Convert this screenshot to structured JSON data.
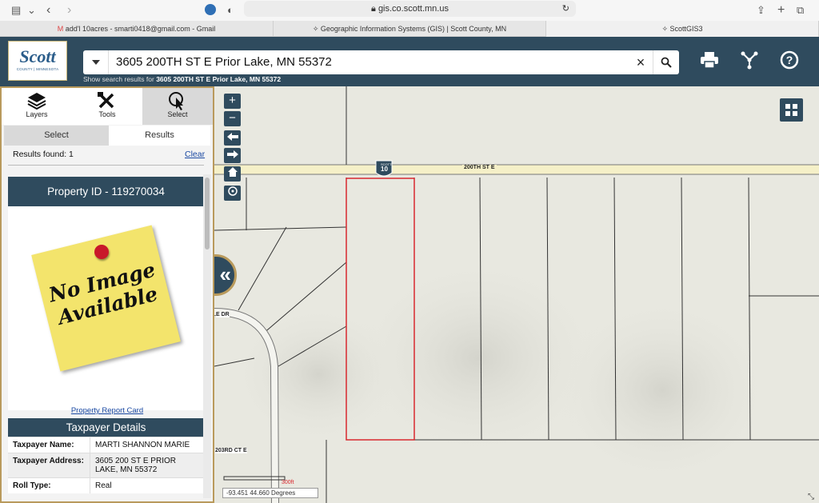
{
  "browser": {
    "url": "gis.co.scott.mn.us",
    "tabs": [
      {
        "label": "add'l 10acres - smarti0418@gmail.com - Gmail"
      },
      {
        "label": "Geographic Information Systems (GIS) | Scott County, MN"
      },
      {
        "label": "ScottGIS3"
      }
    ]
  },
  "header": {
    "logo_main": "Scott",
    "logo_sub": "COUNTY | MINNESOTA",
    "search_value": "3605 200TH ST E Prior Lake, MN 55372",
    "hint_prefix": "Show search results for",
    "hint_query": "3605 200TH ST E Prior Lake, MN 55372"
  },
  "panel": {
    "tabs": [
      {
        "label": "Layers"
      },
      {
        "label": "Tools"
      },
      {
        "label": "Select"
      }
    ],
    "subtabs": [
      {
        "label": "Select"
      },
      {
        "label": "Results"
      }
    ],
    "results_found": "Results found: 1",
    "clear": "Clear",
    "property_id": "Property ID - 119270034",
    "no_image_line1": "No Image",
    "no_image_line2": "Available",
    "property_report_card": "Property Report Card",
    "taxpayer_details": "Taxpayer Details",
    "rows": [
      {
        "key": "Taxpayer Name:",
        "value": "MARTI SHANNON MARIE"
      },
      {
        "key": "Taxpayer Address:",
        "value": "3605 200 ST E PRIOR LAKE, MN 55372"
      },
      {
        "key": "Roll Type:",
        "value": "Real"
      }
    ]
  },
  "map": {
    "road_label": "200TH ST E",
    "shield_top": "SCOTT",
    "shield_num": "10",
    "curve_label": "E DR",
    "road2_label": "203RD CT E",
    "scale_label": "300ft",
    "coords": "-93.451 44.660 Degrees"
  }
}
